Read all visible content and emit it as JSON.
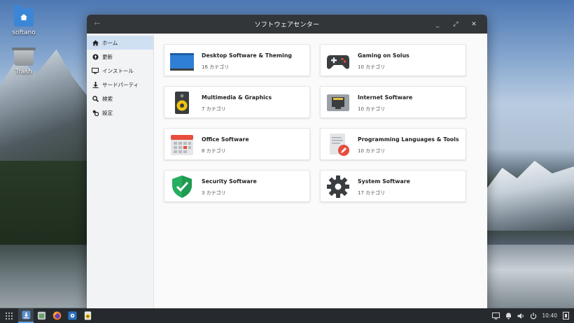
{
  "desktop": {
    "icons": [
      {
        "label": "softano"
      },
      {
        "label": "Trash"
      }
    ]
  },
  "window": {
    "title": "ソフトウェアセンター",
    "back_glyph": "←",
    "controls": {
      "minimize": "_",
      "maximize": "⤢",
      "close": "✕"
    }
  },
  "sidebar": {
    "items": [
      {
        "label": "ホーム",
        "icon": "home-icon",
        "active": true
      },
      {
        "label": "更新",
        "icon": "update-icon"
      },
      {
        "label": "インストール",
        "icon": "monitor-icon"
      },
      {
        "label": "サードパーティ",
        "icon": "download-icon"
      },
      {
        "label": "検索",
        "icon": "search-icon"
      },
      {
        "label": "設定",
        "icon": "settings-icon"
      }
    ]
  },
  "categories": [
    {
      "title": "Desktop Software & Theming",
      "count": "16 カテゴリ",
      "icon": "desktop-icon"
    },
    {
      "title": "Gaming on Solus",
      "count": "10 カテゴリ",
      "icon": "gamepad-icon"
    },
    {
      "title": "Multimedia & Graphics",
      "count": "7 カテゴリ",
      "icon": "speaker-icon"
    },
    {
      "title": "Internet Software",
      "count": "10 カテゴリ",
      "icon": "network-icon"
    },
    {
      "title": "Office Software",
      "count": "8 カテゴリ",
      "icon": "calendar-icon"
    },
    {
      "title": "Programming Languages & Tools",
      "count": "10 カテゴリ",
      "icon": "code-edit-icon"
    },
    {
      "title": "Security Software",
      "count": "3 カテゴリ",
      "icon": "shield-icon"
    },
    {
      "title": "System Software",
      "count": "17 カテゴリ",
      "icon": "gear-icon"
    }
  ],
  "taskbar": {
    "clock": "10:40"
  },
  "colors": {
    "accent": "#cfe0f3",
    "titlebar": "#333639",
    "taskbar": "#262a2e"
  }
}
